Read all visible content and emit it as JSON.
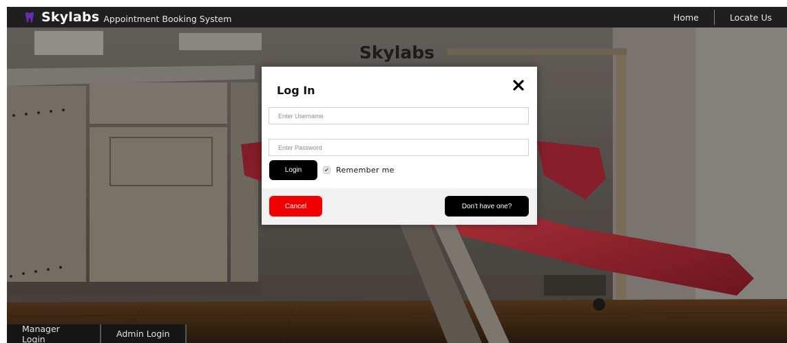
{
  "navbar": {
    "brand_name": "Skylabs",
    "brand_subtitle": "Appointment Booking System",
    "links": [
      "Home",
      "Locate Us"
    ],
    "icon": "tooth-icon"
  },
  "page": {
    "heading": "Skylabs"
  },
  "login_modal": {
    "title": "Log In",
    "close_icon": "close-icon",
    "username_placeholder": "Enter Username",
    "password_placeholder": "Enter Password",
    "login_label": "Login",
    "remember_label": "Remember me",
    "remember_checked": true,
    "cancel_label": "Cancel",
    "signup_label": "Don't have one?"
  },
  "bottom_tabs": [
    "Manager Login",
    "Admin Login"
  ],
  "colors": {
    "navbar_bg": "#1f1f1f",
    "cancel_red": "#f00000",
    "primary_black": "#000000",
    "footer_gray": "#f1f1f1",
    "tooth_purple": "#6a2bb0"
  }
}
